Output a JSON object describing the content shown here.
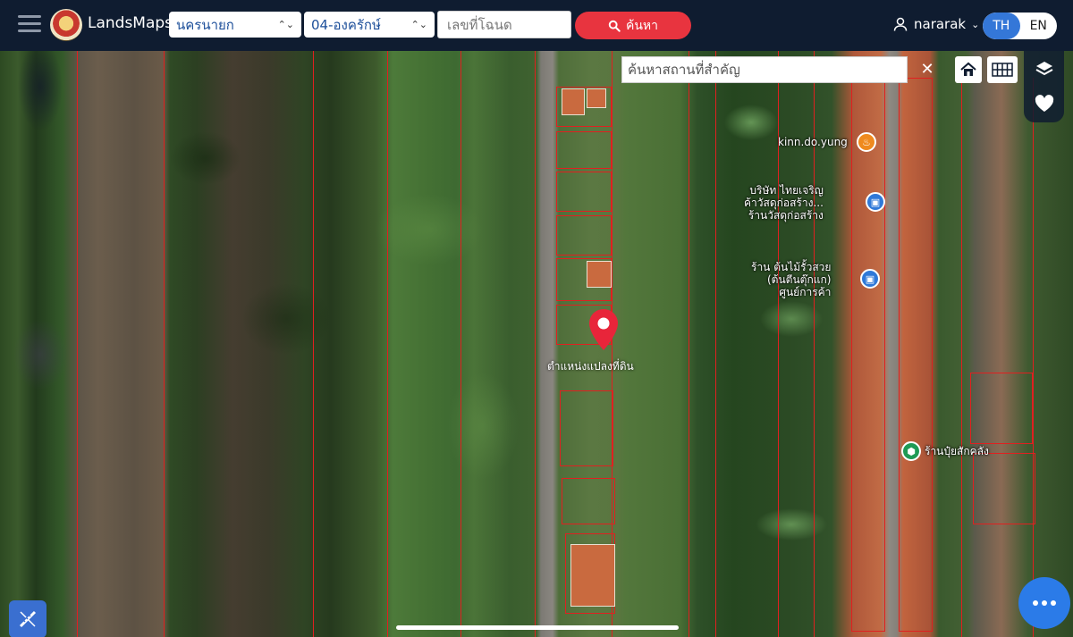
{
  "header": {
    "brand": "LandsMaps",
    "province": "นครนายก",
    "district": "04-องครักษ์",
    "deed_placeholder": "เลขที่โฉนด",
    "search_label": "ค้นหา",
    "username": "nararak",
    "lang_th": "TH",
    "lang_en": "EN",
    "active_lang": "TH"
  },
  "map": {
    "place_search_placeholder": "ค้นหาสถานที่สำคัญ",
    "pin_label": "ตำแหน่งแปลงที่ดิน",
    "pois": [
      {
        "label": "kinn.do.yung",
        "icon": "restaurant-icon"
      },
      {
        "label": "บริษัท ไทยเจริญ\nค้าวัสดุก่อสร้าง...\nร้านวัสดุก่อสร้าง",
        "icon": "shop-icon"
      },
      {
        "label": "ร้าน ต้นไม้รั้วสวย\n(ต้นตีนตุ๊กแก)\nศูนย์การค้า",
        "icon": "shop-icon"
      },
      {
        "label": "ร้านปุ๋ยสักคลัง",
        "icon": "store-icon"
      }
    ]
  },
  "colors": {
    "topbar": "#0f1c30",
    "accent_red": "#e8343f",
    "accent_blue": "#3477d8",
    "parcel_line": "#e02020"
  }
}
